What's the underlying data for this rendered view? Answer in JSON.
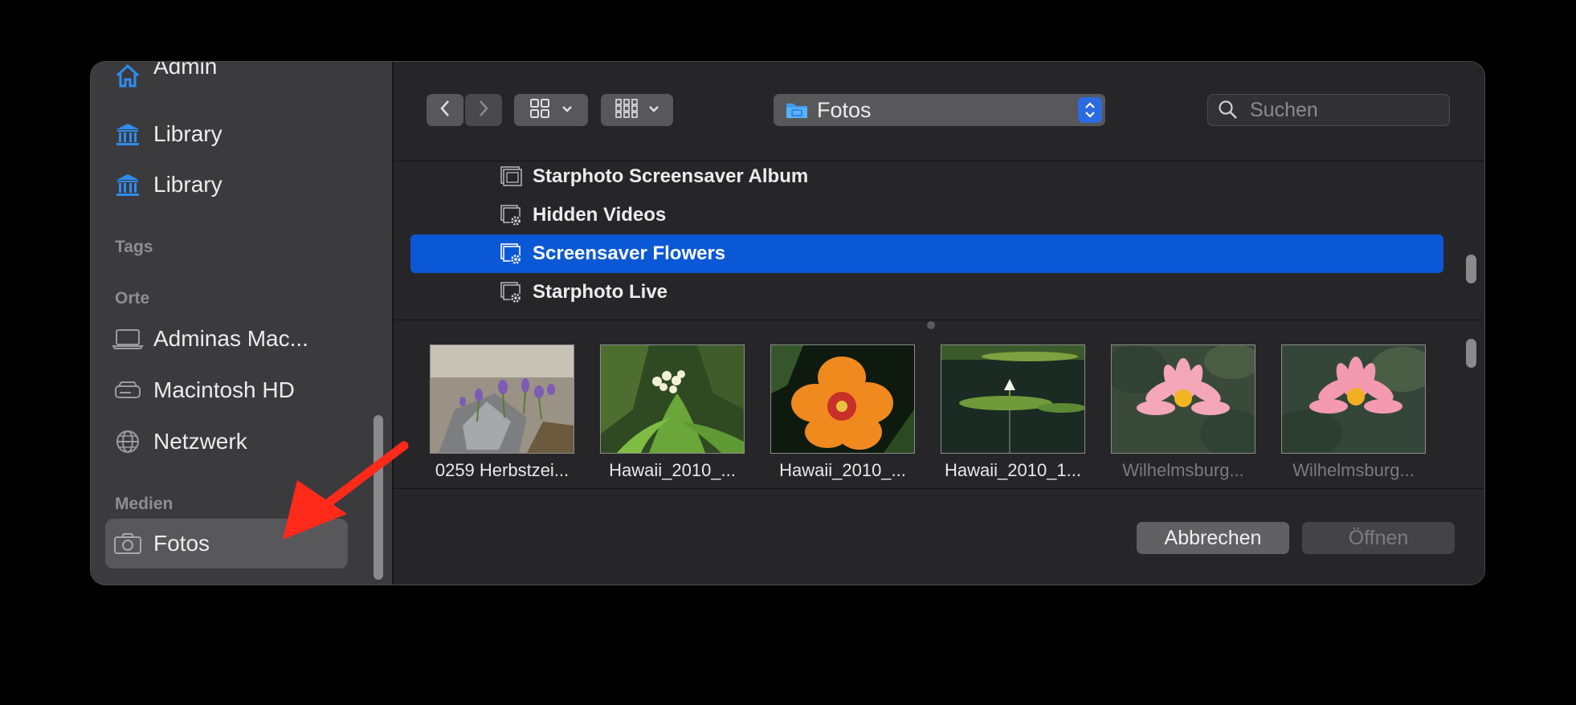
{
  "sidebar": {
    "top_item": {
      "label": "Admin",
      "icon": "home-icon"
    },
    "items": [
      {
        "label": "Library",
        "icon": "library-icon"
      },
      {
        "label": "Library",
        "icon": "library-icon"
      }
    ],
    "tags_header": "Tags",
    "places_header": "Orte",
    "places": [
      {
        "label": "Adminas Mac...",
        "icon": "laptop-icon"
      },
      {
        "label": "Macintosh HD",
        "icon": "disk-icon"
      },
      {
        "label": "Netzwerk",
        "icon": "globe-icon"
      }
    ],
    "media_header": "Medien",
    "media": [
      {
        "label": "Fotos",
        "icon": "camera-icon",
        "selected": true
      }
    ]
  },
  "toolbar": {
    "back_icon": "chevron-left-icon",
    "forward_icon": "chevron-right-icon",
    "view_icon": "grid-icon",
    "group_icon": "group-grid-icon",
    "location": "Fotos",
    "search_placeholder": "Suchen"
  },
  "albums": [
    {
      "label": "Starphoto Screensaver Album",
      "icon": "album-icon",
      "selected": false
    },
    {
      "label": "Hidden Videos",
      "icon": "smart-album-icon",
      "selected": false
    },
    {
      "label": "Screensaver Flowers",
      "icon": "smart-album-icon",
      "selected": true
    },
    {
      "label": "Starphoto Live",
      "icon": "smart-album-icon",
      "selected": false
    }
  ],
  "thumbnails": [
    {
      "caption": "0259 Herbstzei...",
      "dimmed": false
    },
    {
      "caption": "Hawaii_2010_...",
      "dimmed": false
    },
    {
      "caption": "Hawaii_2010_...",
      "dimmed": false
    },
    {
      "caption": "Hawaii_2010_1...",
      "dimmed": false
    },
    {
      "caption": "Wilhelmsburg...",
      "dimmed": true
    },
    {
      "caption": "Wilhelmsburg...",
      "dimmed": true
    }
  ],
  "buttons": {
    "cancel": "Abbrechen",
    "open": "Öffnen"
  },
  "colors": {
    "accent": "#0a58d6",
    "sidebar_icon": "#2f8cf2",
    "annotation_arrow": "#ff2a1a"
  }
}
